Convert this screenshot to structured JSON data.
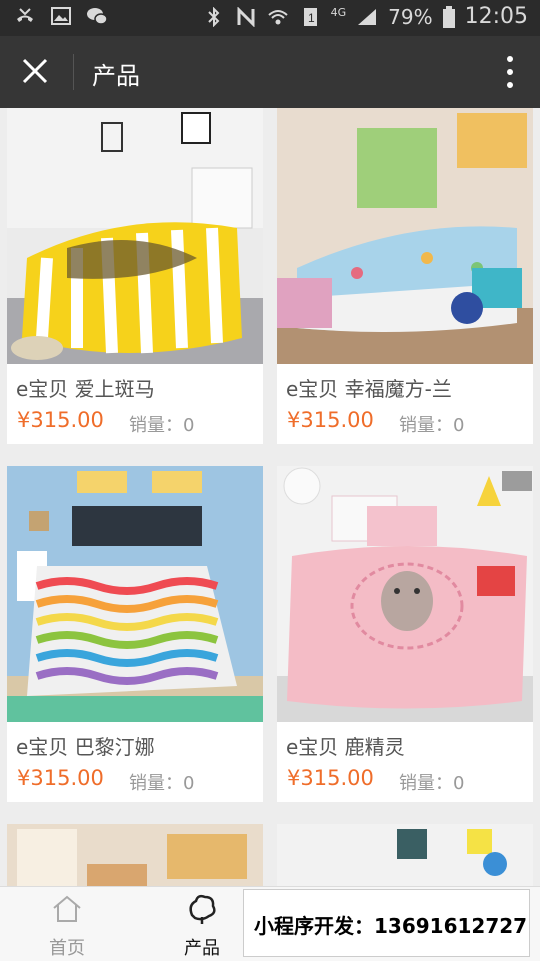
{
  "status_bar": {
    "battery": "79%",
    "time": "12:05",
    "network": "4G"
  },
  "navbar": {
    "title": "产品"
  },
  "products": [
    {
      "name": "e宝贝 爱上斑马",
      "price": "¥315.00",
      "sales": "销量：0"
    },
    {
      "name": "e宝贝 幸福魔方-兰",
      "price": "¥315.00",
      "sales": "销量：0"
    },
    {
      "name": "e宝贝 巴黎汀娜",
      "price": "¥315.00",
      "sales": "销量：0"
    },
    {
      "name": "e宝贝 鹿精灵",
      "price": "¥315.00",
      "sales": "销量：0"
    }
  ],
  "tabbar": {
    "home_label": "首页",
    "products_label": "产品"
  },
  "ad": {
    "text": "小程序开发：13691612727"
  },
  "colors": {
    "price": "#ef6d2a",
    "navbar": "#363636",
    "statusbar": "#2b2b2b"
  }
}
